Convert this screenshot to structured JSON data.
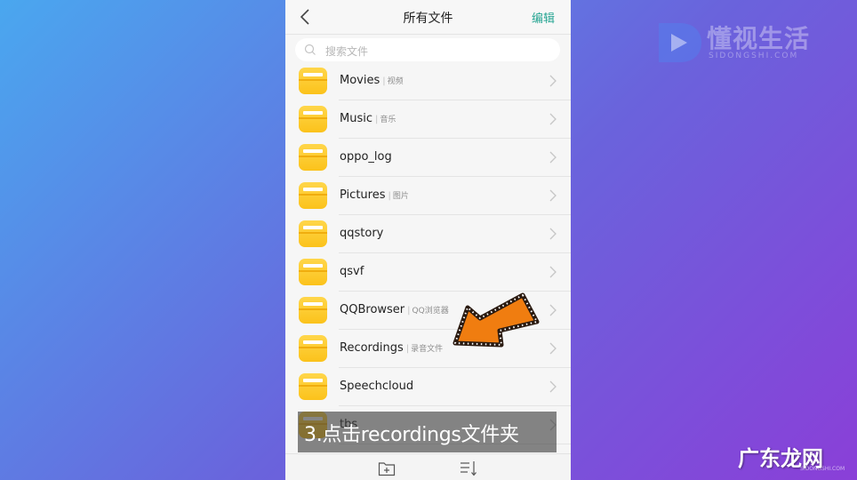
{
  "header": {
    "title": "所有文件",
    "edit_label": "编辑"
  },
  "search": {
    "placeholder": "搜索文件"
  },
  "folders": [
    {
      "name": "Movies",
      "sub": "视频"
    },
    {
      "name": "Music",
      "sub": "音乐"
    },
    {
      "name": "oppo_log",
      "sub": ""
    },
    {
      "name": "Pictures",
      "sub": "图片"
    },
    {
      "name": "qqstory",
      "sub": ""
    },
    {
      "name": "qsvf",
      "sub": ""
    },
    {
      "name": "QQBrowser",
      "sub": "QQ浏览器"
    },
    {
      "name": "Recordings",
      "sub": "录音文件"
    },
    {
      "name": "Speechcloud",
      "sub": ""
    },
    {
      "name": "tbs",
      "sub": ""
    }
  ],
  "caption": "3.点击recordings文件夹",
  "watermark": {
    "title": "懂视生活",
    "site": "SIDONGSHI.COM"
  },
  "corner_watermark": {
    "title": "广东龙网",
    "site": "SIDONGSHI.COM"
  },
  "colors": {
    "accent": "#27a593",
    "folder": "#fbc21b",
    "arrow": "#f07d10"
  },
  "icons": {
    "back": "chevron-left-icon",
    "search": "search-icon",
    "row": "chevron-right-icon",
    "new_folder": "new-folder-icon",
    "sort": "sort-icon"
  }
}
